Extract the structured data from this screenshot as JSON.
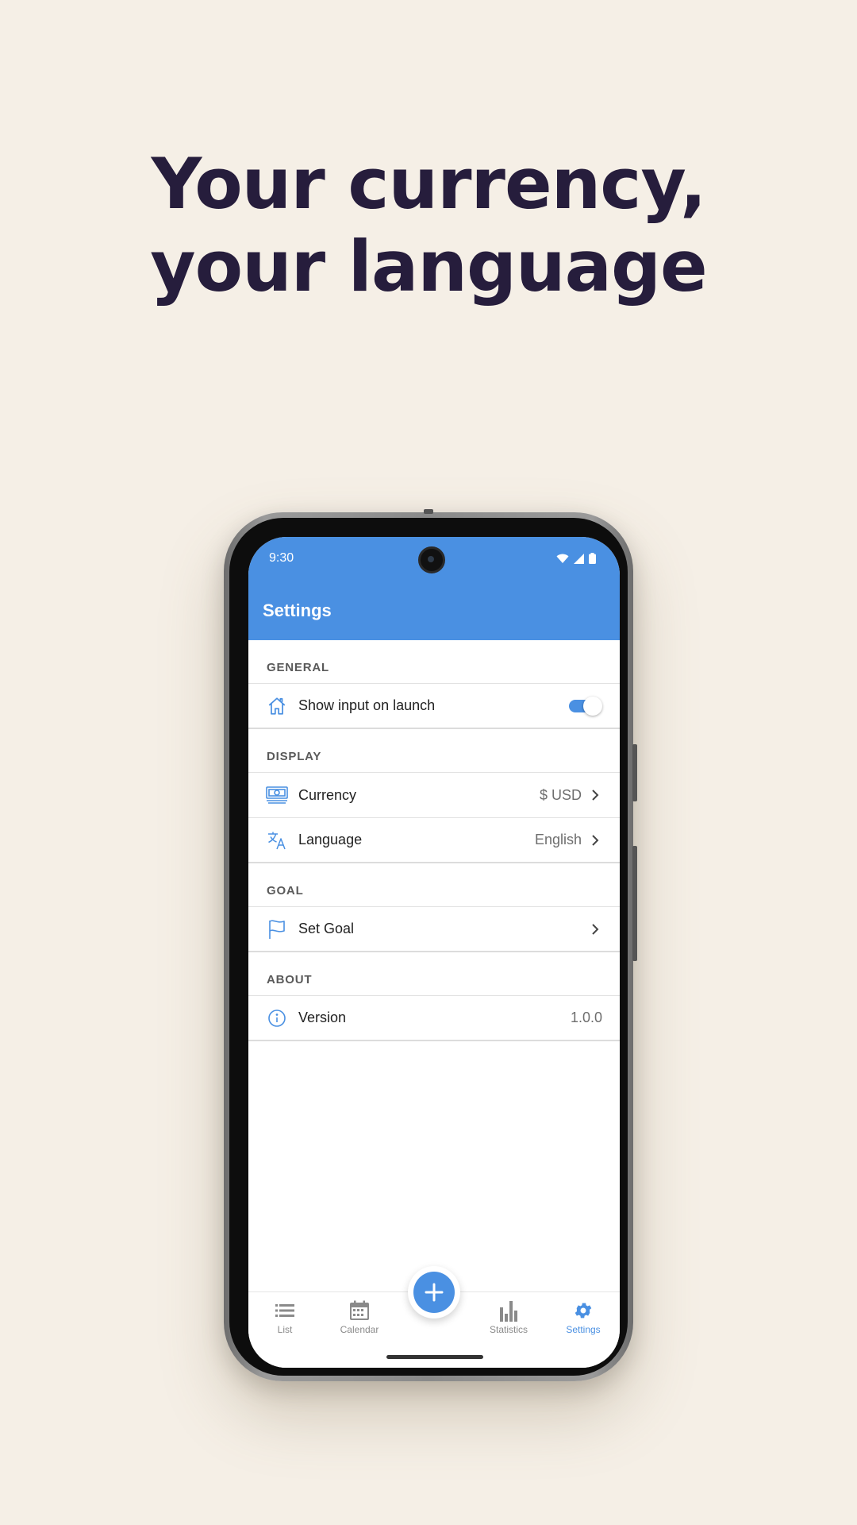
{
  "headline": {
    "line1": "Your currency,",
    "line2": "your language"
  },
  "status_bar": {
    "time": "9:30",
    "icons": [
      "wifi-icon",
      "signal-icon",
      "battery-icon"
    ]
  },
  "app_bar": {
    "title": "Settings"
  },
  "sections": {
    "general": {
      "header": "GENERAL",
      "show_input": {
        "label": "Show input on launch",
        "icon": "home-icon",
        "enabled": true
      }
    },
    "display": {
      "header": "DISPLAY",
      "currency": {
        "label": "Currency",
        "value": "$ USD",
        "icon": "money-icon"
      },
      "language": {
        "label": "Language",
        "value": "English",
        "icon": "translate-icon"
      }
    },
    "goal": {
      "header": "GOAL",
      "set_goal": {
        "label": "Set Goal",
        "icon": "flag-icon"
      }
    },
    "about": {
      "header": "ABOUT",
      "version": {
        "label": "Version",
        "value": "1.0.0",
        "icon": "info-icon"
      }
    }
  },
  "bottom_nav": {
    "list": "List",
    "calendar": "Calendar",
    "statistics": "Statistics",
    "settings": "Settings",
    "active": "settings"
  },
  "colors": {
    "background": "#f5efe6",
    "headline": "#261d3c",
    "accent": "#4a90e2"
  }
}
